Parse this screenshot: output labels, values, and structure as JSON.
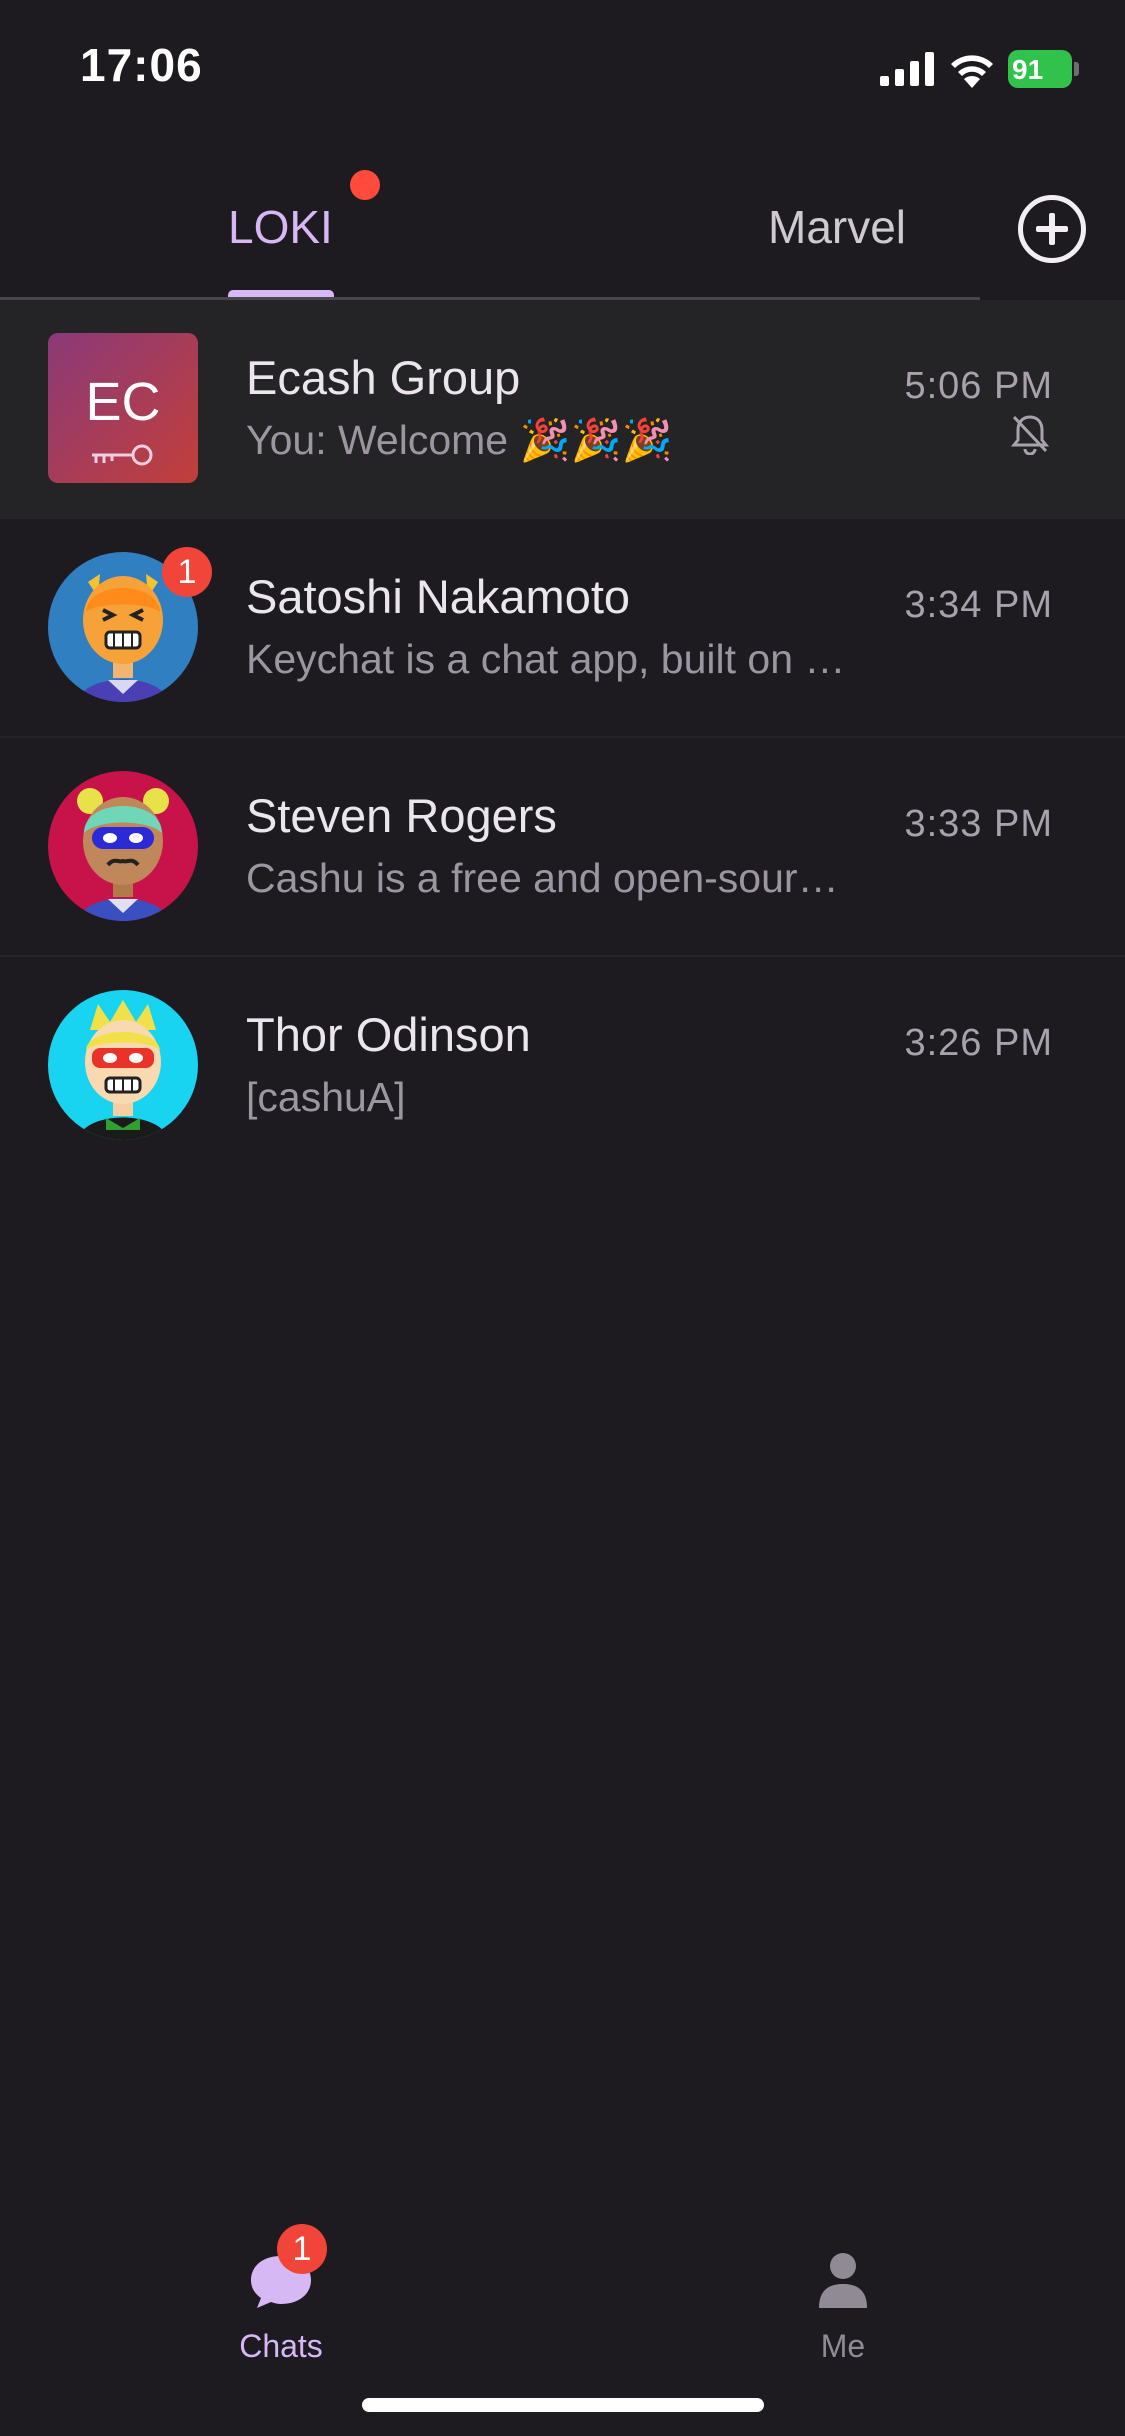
{
  "status_bar": {
    "time": "17:06",
    "battery_level": "91",
    "icons": [
      "signal-icon",
      "wifi-icon",
      "battery-icon"
    ]
  },
  "tabs": [
    {
      "label": "LOKI",
      "active": true,
      "has_dot": true
    },
    {
      "label": "Marvel",
      "active": false
    }
  ],
  "add_icon": "plus-circle-icon",
  "chats": [
    {
      "name": "Ecash Group",
      "preview": "You: Welcome 🎉🎉🎉",
      "time": "5:06 PM",
      "avatar_initials": "EC",
      "muted": true,
      "unread": ""
    },
    {
      "name": "Satoshi Nakamoto",
      "preview": "Keychat is a chat app, built on Nostr",
      "time": "3:34 PM",
      "unread": "1"
    },
    {
      "name": "Steven Rogers",
      "preview": "Cashu is a free and open-source Chaumian ecash protocol",
      "time": "3:33 PM",
      "unread": ""
    },
    {
      "name": "Thor Odinson",
      "preview": "[cashuA]",
      "time": "3:26 PM",
      "unread": ""
    }
  ],
  "bottom_nav": {
    "chats_label": "Chats",
    "chats_badge": "1",
    "me_label": "Me"
  },
  "colors": {
    "background": "#1e1b20",
    "accent": "#d6b8f5",
    "badge": "#f2453a",
    "battery": "#30c24a"
  }
}
